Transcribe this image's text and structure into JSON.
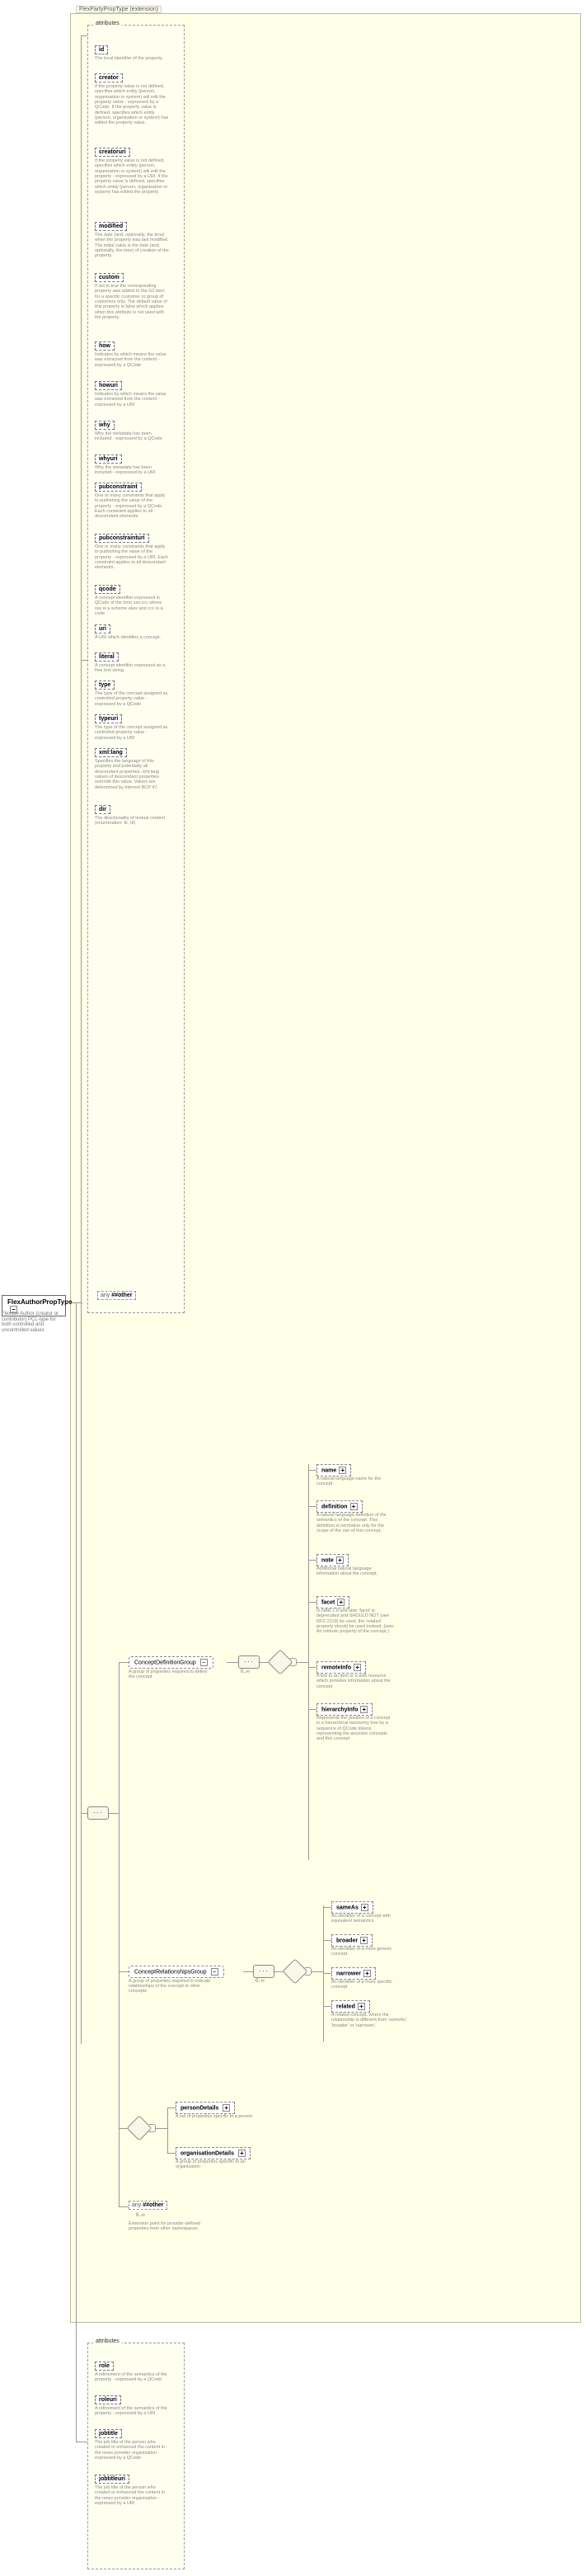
{
  "ext_label": "FlexPartyPropType (extension)",
  "root": {
    "name": "FlexAuthorPropType",
    "desc": "Flexible Author (creator or contributor) PCL-type for both controlled and uncontrolled values"
  },
  "attributes_label": "attributes",
  "top_attributes": [
    {
      "name": "id",
      "desc": "The local identifier of the property."
    },
    {
      "name": "creator",
      "desc": "If the property value is not defined, specifies which entity (person, organisation or system) will edit the property value - expressed by a QCode. If the property value is defined, specifies which entity (person, organisation or system) has edited the property value."
    },
    {
      "name": "creatoruri",
      "desc": "If the property value is not defined, specifies which entity (person, organisation or system) will edit the property - expressed by a URI. If the property value is defined, specifies which entity (person, organisation or system) has edited the property."
    },
    {
      "name": "modified",
      "desc": "The date (and, optionally, the time) when the property was last modified. The initial value is the date (and, optionally, the time) of creation of the property."
    },
    {
      "name": "custom",
      "desc": "If set to true the corresponding property was added to the G2 Item for a specific customer or group of customers only. The default value of this property is false which applies when this attribute is not used with the property."
    },
    {
      "name": "how",
      "desc": "Indicates by which means the value was extracted from the content - expressed by a QCode"
    },
    {
      "name": "howuri",
      "desc": "Indicates by which means the value was extracted from the content - expressed by a URI"
    },
    {
      "name": "why",
      "desc": "Why the metadata has been included - expressed by a QCode"
    },
    {
      "name": "whyuri",
      "desc": "Why the metadata has been included - expressed by a URI"
    },
    {
      "name": "pubconstraint",
      "desc": "One or many constraints that apply to publishing the value of the property - expressed by a QCode. Each constraint applies to all descendant elements."
    },
    {
      "name": "pubconstrainturi",
      "desc": "One or many constraints that apply to publishing the value of the property - expressed by a URI. Each constraint applies to all descendant elements."
    },
    {
      "name": "qcode",
      "desc": "A concept identifier expressed in QCode of the form sss:ccc where sss is a scheme alias and ccc is a code."
    },
    {
      "name": "uri",
      "desc": "A URI which identifies a concept."
    },
    {
      "name": "literal",
      "desc": "A concept identifier expressed as a free text string."
    },
    {
      "name": "type",
      "desc": "The type of the concept assigned as controlled property value - expressed by a QCode"
    },
    {
      "name": "typeuri",
      "desc": "The type of the concept assigned as controlled property value - expressed by a URI"
    },
    {
      "name": "xml:lang",
      "desc": "Specifies the language of this property and potentially all descendant properties. xml:lang values of descendant properties override this value. Values are determined by Internet BCP 47."
    },
    {
      "name": "dir",
      "desc": "The directionality of textual content (enumeration: ltr, rtl)"
    }
  ],
  "any_other": "##other",
  "concept_def": {
    "label": "ConceptDefinitionGroup",
    "desc": "A group of properties required to define the concept",
    "children": [
      {
        "name": "name",
        "desc": "A natural language name for the concept."
      },
      {
        "name": "definition",
        "desc": "A natural language definition of the semantics of the concept. This definition is normative only for the scope of the use of this concept."
      },
      {
        "name": "note",
        "desc": "Additional natural language information about the concept."
      },
      {
        "name": "facet",
        "desc": "In NAR 1.8 and later 'facet' is deprecated and SHOULD NOT (see RFC 2119) be used, the 'related' property should be used instead. (was: An intrinsic property of the concept.)"
      },
      {
        "name": "remoteInfo",
        "desc": "A link to an item or a web resource which provides information about the concept"
      },
      {
        "name": "hierarchyInfo",
        "desc": "Represents the position of a concept in a hierarchical taxonomy tree by a sequence of QCode tokens representing the ancestor concepts and this concept"
      }
    ]
  },
  "concept_rel": {
    "label": "ConceptRelationshipsGroup",
    "desc": "A group of properties required to indicate relationships of the concept to other concepts",
    "children": [
      {
        "name": "sameAs",
        "desc": "An identifier of a concept with equivalent semantics"
      },
      {
        "name": "broader",
        "desc": "An identifier of a more generic concept."
      },
      {
        "name": "narrower",
        "desc": "An identifier of a more specific concept."
      },
      {
        "name": "related",
        "desc": "A related concept, where the relationship is different from 'sameAs', 'broader' or 'narrower'."
      }
    ]
  },
  "person_details": {
    "name": "personDetails",
    "desc": "A set of properties specific to a person"
  },
  "org_details": {
    "name": "organisationDetails",
    "desc": "A group of properties specific to an organisation"
  },
  "any_other2": "##other",
  "any_other2_desc": "Extension point for provider-defined properties from other namespaces",
  "bottom_attributes": [
    {
      "name": "role",
      "desc": "A refinement of the semantics of the property - expressed by a QCode"
    },
    {
      "name": "roleuri",
      "desc": "A refinement of the semantics of the property - expressed by a URI"
    },
    {
      "name": "jobtitle",
      "desc": "The job title of the person who created or enhanced the content in the news provider organisation - expressed by a QCode"
    },
    {
      "name": "jobtitleuri",
      "desc": "The job title of the person who created or enhanced the content in the news provider organisation - expressed by a URI"
    }
  ],
  "card_unbounded": "0..∞"
}
